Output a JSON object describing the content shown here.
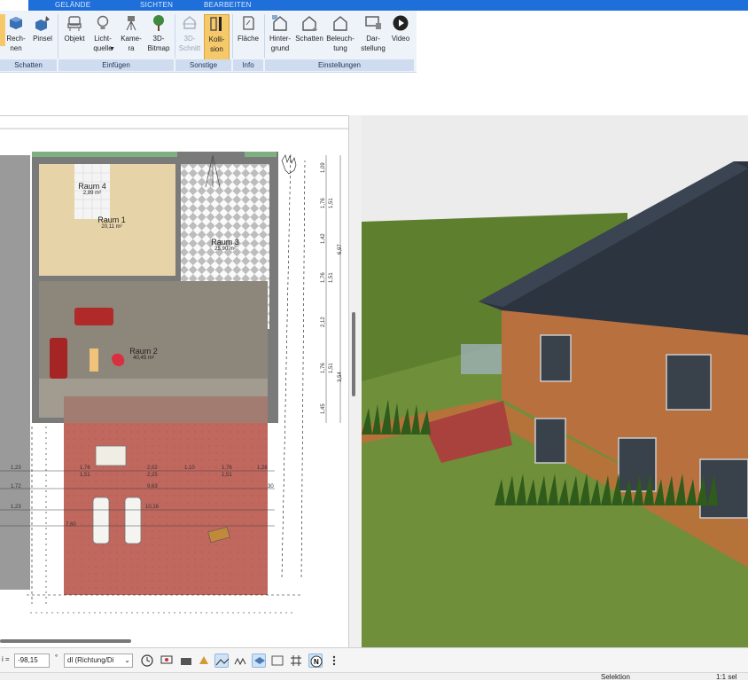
{
  "ribbon_tabs": [
    "GELÄNDE",
    "SICHTEN",
    "BEARBEITEN"
  ],
  "ribbon_buttons": {
    "rechnen": "Rech-\nnen",
    "pinsel": "Pinsel",
    "objekt": "Objekt",
    "lichtquelle": "Licht-\nquelle",
    "kamera": "Kame-\nra",
    "bitmap": "3D-\nBitmap",
    "schnitt": "3D-\nSchnitt",
    "kollision": "Kolli-\nsion",
    "flaeche": "Fläche",
    "hintergrund": "Hinter-\ngrund",
    "schatten": "Schatten",
    "beleuchtung": "Beleuch-\ntung",
    "darstellung": "Dar-\nstellung",
    "video": "Video"
  },
  "ribbon_groups": [
    "Schatten",
    "Einfügen",
    "Sonstige",
    "Info",
    "Einstellungen"
  ],
  "rooms": [
    {
      "name": "Raum 4",
      "area": "2,89 m²"
    },
    {
      "name": "Raum 1",
      "area": "20,11 m²"
    },
    {
      "name": "Raum 3",
      "area": "25,90 m²"
    },
    {
      "name": "Raum 2",
      "area": "40,45 m²"
    }
  ],
  "right_dims": [
    "1,09",
    "1,76",
    "1,51",
    "1,42",
    "6,97",
    "1,76",
    "1,51",
    "2,12",
    "1,76",
    "1,51",
    "3,54",
    "1,45"
  ],
  "bottom_dims": {
    "row1": [
      "1,23",
      "1,76",
      "2,02",
      "1,10",
      "1,76",
      "1,26"
    ],
    "row1b": [
      "1,51",
      "2,25",
      "1,51"
    ],
    "row2": [
      "1,72",
      "9,63"
    ],
    "row3": [
      "1,23",
      "10,16"
    ],
    "row4": [
      "7,60"
    ],
    "row2_end": "30"
  },
  "bottom_toolbar": {
    "field_prefix": "i =",
    "field_value": "-98,15",
    "unit": "°",
    "dropdown": "dl (Richtung/Di"
  },
  "status": {
    "mode": "Selektion",
    "scale": "1:1 sel"
  },
  "colors": {
    "accent": "#1e6fd9",
    "active_button": "#f5c96a",
    "roof": "#2c3440",
    "facade": "#b9703f",
    "lawn": "#6f8f3a",
    "terrace": "#b14a4a"
  }
}
